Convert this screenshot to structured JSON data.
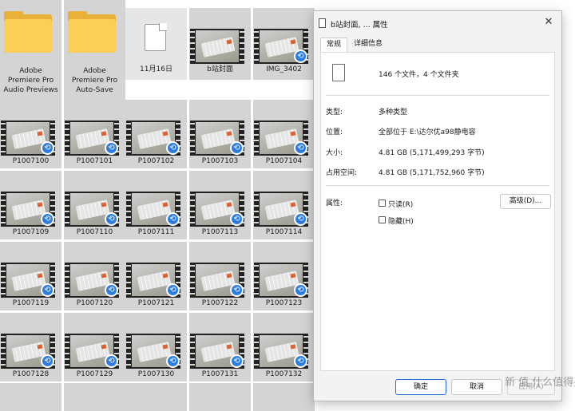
{
  "explorer": {
    "folders": [
      {
        "label": "Adobe\nPremiere Pro\nAudio Previews"
      },
      {
        "label": "Adobe\nPremiere Pro\nAuto-Save"
      }
    ],
    "top_items": [
      "11月16日",
      "b站封面",
      "IMG_3402"
    ],
    "rows": [
      [
        "P1007100",
        "P1007101",
        "P1007102",
        "P1007103",
        "P1007104"
      ],
      [
        "P1007109",
        "P1007110",
        "P1007111",
        "P1007113",
        "P1007114"
      ],
      [
        "P1007119",
        "P1007120",
        "P1007121",
        "P1007122",
        "P1007123"
      ],
      [
        "P1007128",
        "P1007129",
        "P1007130",
        "P1007131",
        "P1007132"
      ]
    ],
    "sync_icon": "sync-arrow-icon"
  },
  "dialog": {
    "title": "b站封面, ... 属性",
    "close_symbol": "✕",
    "tabs": [
      "常规",
      "详细信息"
    ],
    "summary": "146 个文件，4 个文件夹",
    "rows": [
      {
        "label": "类型:",
        "value": "多种类型"
      },
      {
        "label": "位置:",
        "value": "全部位于 E:\\达尔优a98静电容"
      },
      {
        "label": "大小:",
        "value": "4.81 GB (5,171,499,293 字节)"
      },
      {
        "label": "占用空间:",
        "value": "4.81 GB (5,171,752,960 字节)"
      }
    ],
    "attributes_label": "属性:",
    "readonly_label": "只读(R)",
    "hidden_label": "隐藏(H)",
    "advanced_label": "高级(D)...",
    "ok_label": "确定",
    "cancel_label": "取消",
    "apply_label": "应用(A)"
  },
  "watermark": "新 值 什么值得买",
  "colors": {
    "accent": "#2a6ad0",
    "sync_badge": "#2d7de0",
    "folder": "#f9cf57"
  }
}
